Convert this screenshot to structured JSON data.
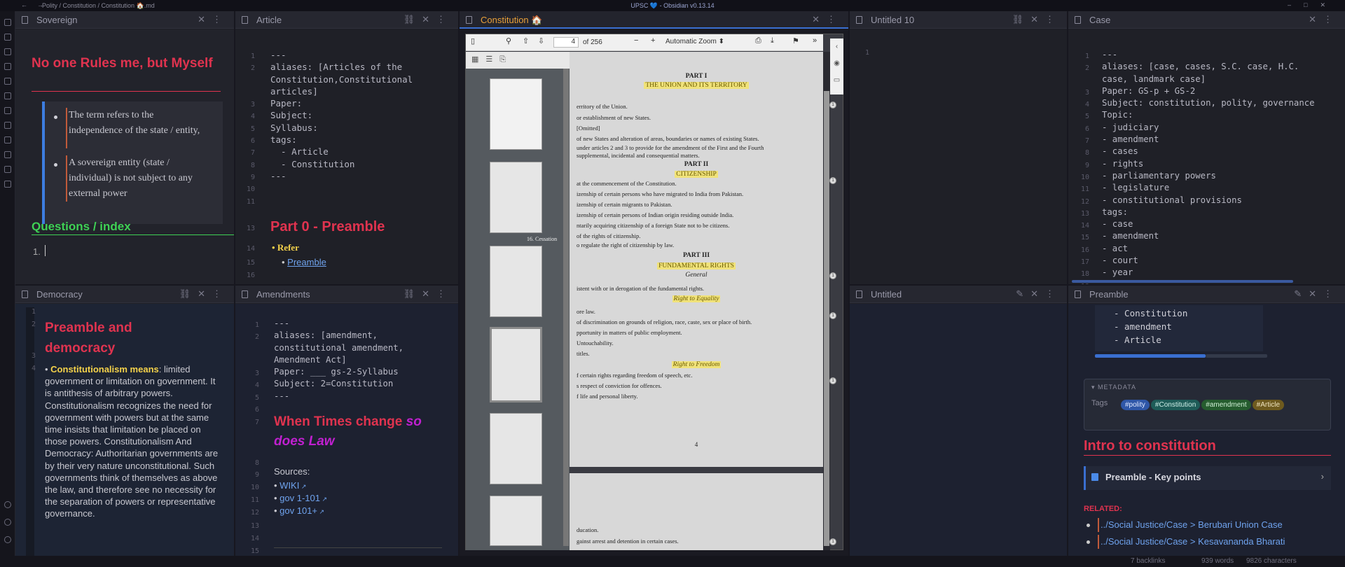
{
  "app": {
    "path": "Polity / Constitution / Constitution 🏠.md",
    "title": "UPSC 💙 - Obsidian v0.13.14"
  },
  "colors": {
    "accent_red": "#e0334f",
    "accent_green": "#3fd155",
    "link": "#6fa3ee",
    "bg": "#1e1f26"
  },
  "panes": {
    "sovereign": {
      "title": "Sovereign",
      "heading": "No one Rules me, but Myself",
      "bullets": [
        "The term refers to the independence of the state / entity,",
        "A sovereign entity (state / individual) is not subject to any external power"
      ],
      "h2": "Questions / index",
      "list_num": "1."
    },
    "article": {
      "title": "Article",
      "lines": [
        "---",
        "aliases: [Articles of the",
        "Constitution,Constitutional",
        "articles]",
        "Paper:",
        "Subject:",
        "Syllabus:",
        "tags:",
        "  - Article",
        "  - Constitution",
        "---"
      ],
      "nums": [
        "1",
        "2",
        "",
        "",
        "3",
        "4",
        "5",
        "6",
        "7",
        "8",
        "9",
        "10",
        "11",
        "12"
      ],
      "heading": "Part 0 - Preamble",
      "h_num": "13",
      "refer": "Refer",
      "refer_num": "14",
      "link": "Preamble",
      "link_num": "15",
      "after_nums": [
        "16",
        "17"
      ]
    },
    "constitution": {
      "title": "Constitution 🏠",
      "page": "4",
      "of": "of 256",
      "zoom": "Automatic Zoom"
    },
    "untitled10": {
      "title": "Untitled 10",
      "line_num": "1"
    },
    "case": {
      "title": "Case",
      "lines": [
        "---",
        "aliases: [case, cases, S.C. case, H.C.",
        "case, landmark case]",
        "Paper: GS-p + GS-2",
        "Subject: constitution, polity, governance",
        "Topic:",
        "- judiciary",
        "- amendment",
        "- cases",
        "- rights",
        "- parliamentary powers",
        "- legislature",
        "- constitutional provisions",
        "tags:",
        "- case",
        "- amendment",
        "- act",
        "- court",
        "- year",
        "---"
      ],
      "nums": [
        "1",
        "2",
        "",
        "3",
        "4",
        "5",
        "6",
        "7",
        "8",
        "9",
        "10",
        "11",
        "12",
        "13",
        "14",
        "15",
        "16",
        "17",
        "18",
        "19"
      ]
    },
    "democracy": {
      "title": "Democracy",
      "heading": "Preamble and democracy",
      "nums": [
        "1",
        "2",
        "",
        "3",
        "4"
      ],
      "bold": "Constitutionalism means",
      "text": ": limited government or limitation on government. It is antithesis of arbitrary powers. Constitutionalism recognizes the need for government with powers but at the same time insists that limitation be placed on those powers. Constitutionalism And Democracy: Authoritarian governments are by their very nature unconstitutional. Such governments think of themselves as above the law, and therefore see no necessity for the separation of powers or representative governance."
    },
    "amendments": {
      "title": "Amendments",
      "lines": [
        "---",
        "aliases: [amendment,",
        "constitutional amendment,",
        "Amendment Act]",
        "Paper: ___ gs-2-Syllabus",
        "Subject: 2=Constitution",
        "---"
      ],
      "nums": [
        "1",
        "2",
        "",
        "",
        "3",
        "4",
        "5",
        "6",
        "",
        "7"
      ],
      "heading_a": "When Times change ",
      "heading_b": "so does Law",
      "sources": "Sources:",
      "links": [
        "WIKI",
        "gov 1-101",
        "gov 101+"
      ],
      "lnums": [
        "8",
        "9",
        "10",
        "11",
        "12",
        "13",
        "14",
        "15"
      ]
    },
    "untitled": {
      "title": "Untitled"
    },
    "preamble": {
      "title": "Preamble",
      "list": [
        "- Constitution",
        "- amendment",
        "- Article"
      ],
      "meta_label": "METADATA",
      "tags_label": "Tags",
      "tags": [
        "#polity",
        "#Constitution",
        "#amendment",
        "#Article"
      ],
      "heading": "Intro to constitution",
      "callout": "Preamble - Key points",
      "related": "RELATED:",
      "rel_links": [
        "../Social Justice/Case > Berubari Union Case",
        "../Social Justice/Case > Kesavananda Bharati"
      ]
    }
  },
  "pdf": {
    "p1": [
      {
        "t": "PART I",
        "c": "heading"
      },
      {
        "t": "THE UNION AND ITS TERRITORY",
        "c": "hl"
      },
      {
        "t": "erritory of the Union.",
        "c": "l"
      },
      {
        "t": "or establishment of new States.",
        "c": "l"
      },
      {
        "t": "[Omitted]",
        "c": "l"
      },
      {
        "t": "of new States and alteration of areas, boundaries or names of existing States.",
        "c": "l"
      },
      {
        "t": "under articles 2 and 3 to provide for the amendment of the First and the Fourth",
        "c": "l"
      },
      {
        "t": "supplemental, incidental and consequential matters.",
        "c": "l"
      },
      {
        "t": "PART II",
        "c": "heading"
      },
      {
        "t": "CITIZENSHIP",
        "c": "hl"
      },
      {
        "t": "at the commencement of the Constitution.",
        "c": "l"
      },
      {
        "t": "izenship of certain persons who have migrated to India from Pakistan.",
        "c": "l"
      },
      {
        "t": "izenship of certain migrants to Pakistan.",
        "c": "l"
      },
      {
        "t": "izenship of certain persons of Indian origin residing outside India.",
        "c": "l"
      },
      {
        "t": "ntarily acquiring citizenship of a foreign State not to be citizens.",
        "c": "l"
      },
      {
        "t": "of the rights of citizenship.",
        "c": "l"
      },
      {
        "t": "o regulate the right of citizenship by law.",
        "c": "l"
      },
      {
        "t": "PART III",
        "c": "heading"
      },
      {
        "t": "FUNDAMENTAL RIGHTS",
        "c": "hl"
      },
      {
        "t": "General",
        "c": "it"
      },
      {
        "t": "istent with or in derogation of the fundamental rights.",
        "c": "l"
      },
      {
        "t": "Right to Equality",
        "c": "hlit"
      },
      {
        "t": "ore law.",
        "c": "l"
      },
      {
        "t": "of discrimination on grounds of religion, race, caste, sex or place of birth.",
        "c": "l"
      },
      {
        "t": "pportunity in matters of public employment.",
        "c": "l"
      },
      {
        "t": "Untouchability.",
        "c": "l"
      },
      {
        "t": "titles.",
        "c": "l"
      },
      {
        "t": "Right to Freedom",
        "c": "hlit"
      },
      {
        "t": "f certain rights regarding freedom of speech, etc.",
        "c": "l"
      },
      {
        "t": "s respect of conviction for offences.",
        "c": "l"
      },
      {
        "t": "f life and personal liberty.",
        "c": "l"
      }
    ],
    "pagenum": "4",
    "p2": [
      "ducation.",
      "gainst arrest and detention in certain cases."
    ],
    "thumb_label": "16. Cessation"
  },
  "statusbar": {
    "backlinks": "7 backlinks",
    "words": "939 words",
    "chars": "9826 characters"
  }
}
